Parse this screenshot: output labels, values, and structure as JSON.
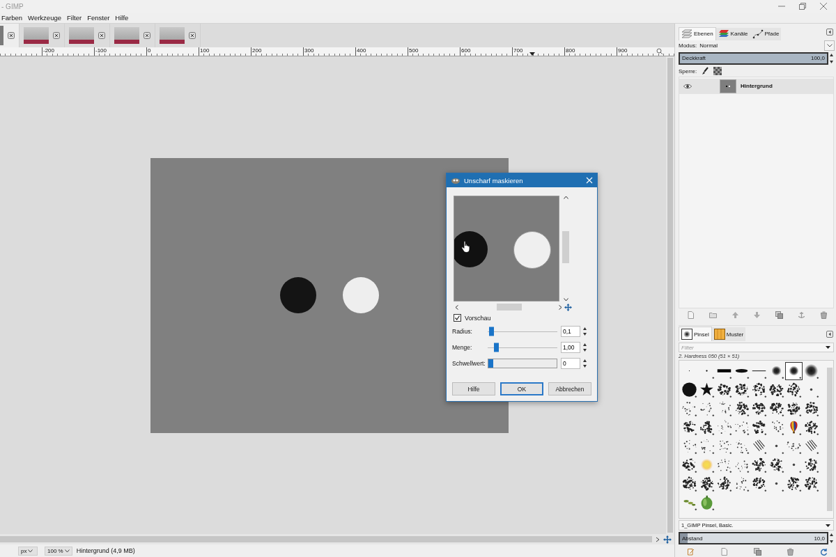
{
  "window": {
    "title": "- GIMP"
  },
  "menu": [
    "Farben",
    "Werkzeuge",
    "Filter",
    "Fenster",
    "Hilfe"
  ],
  "image_tabs": [
    {
      "kind": "blank",
      "selected": true
    },
    {
      "kind": "photo",
      "selected": false
    },
    {
      "kind": "photo",
      "selected": false
    },
    {
      "kind": "photo",
      "selected": false
    },
    {
      "kind": "photo",
      "selected": false
    }
  ],
  "ruler": {
    "labels": [
      "-200",
      "-100",
      "0",
      "100",
      "200",
      "300",
      "400",
      "500",
      "600",
      "700",
      "800",
      "900"
    ]
  },
  "dialog": {
    "title": "Unscharf maskieren",
    "preview": {
      "label": "Vorschau",
      "checked": true
    },
    "params": [
      {
        "kind": "slider",
        "label": "Radius:",
        "value": "0,1",
        "level": 0.02
      },
      {
        "kind": "slider",
        "label": "Menge:",
        "value": "1,00",
        "level": 0.1
      },
      {
        "kind": "scale",
        "label": "Schwellwert:",
        "value": "0",
        "level": 0
      }
    ],
    "buttons": [
      {
        "label": "Hilfe",
        "selected": false
      },
      {
        "label": "OK",
        "selected": true
      },
      {
        "label": "Abbrechen",
        "selected": false
      }
    ]
  },
  "status_bar": {
    "unit": "px",
    "zoom": "100 %",
    "info": "Hintergrund (4,9 MB)"
  },
  "layers_panel": {
    "tabs": [
      {
        "label": "Ebenen",
        "selected": true
      },
      {
        "label": "Kanäle",
        "selected": false
      },
      {
        "label": "Pfade",
        "selected": false
      }
    ],
    "mode_label": "Modus:",
    "mode": "Normal",
    "opacity": {
      "label": "Deckkraft",
      "value": "100,0",
      "level": 1
    },
    "lock_label": "Sperre:",
    "layers": [
      {
        "name": "Hintergrund",
        "visible": true,
        "selected": true
      }
    ]
  },
  "brushes_panel": {
    "tabs": [
      {
        "label": "Pinsel",
        "selected": true
      },
      {
        "label": "Muster",
        "selected": false
      }
    ],
    "filter": {
      "placeholder": "Filter"
    },
    "brush_name": "2. Hardness 050 (51 × 51)",
    "brushes": [
      {
        "kind": "pixel",
        "selected": false
      },
      {
        "kind": "dot",
        "selected": false
      },
      {
        "kind": "bar",
        "selected": false
      },
      {
        "kind": "ellipse",
        "selected": false
      },
      {
        "kind": "line",
        "selected": false
      },
      {
        "kind": "soft",
        "selected": false
      },
      {
        "kind": "soft",
        "selected": true
      },
      {
        "kind": "soft-large",
        "selected": false
      },
      {
        "kind": "disc",
        "selected": false
      },
      {
        "kind": "star",
        "selected": false
      },
      {
        "kind": "blob",
        "selected": false
      },
      {
        "kind": "blob",
        "selected": false
      },
      {
        "kind": "blob",
        "selected": false
      },
      {
        "kind": "blob",
        "selected": false
      },
      {
        "kind": "blob",
        "selected": false
      },
      {
        "kind": "speck",
        "selected": false
      },
      {
        "kind": "sparse",
        "selected": false
      },
      {
        "kind": "sparse",
        "selected": false
      },
      {
        "kind": "sparse",
        "selected": false
      },
      {
        "kind": "blob",
        "selected": false
      },
      {
        "kind": "blob",
        "selected": false
      },
      {
        "kind": "blob",
        "selected": false
      },
      {
        "kind": "blob",
        "selected": false
      },
      {
        "kind": "blob",
        "selected": false
      },
      {
        "kind": "blob",
        "selected": false
      },
      {
        "kind": "blob",
        "selected": false
      },
      {
        "kind": "sparse",
        "selected": false
      },
      {
        "kind": "sparse",
        "selected": false
      },
      {
        "kind": "blob",
        "selected": false
      },
      {
        "kind": "sparse",
        "selected": false
      },
      {
        "kind": "balloon",
        "selected": false
      },
      {
        "kind": "blob",
        "selected": false
      },
      {
        "kind": "sparse",
        "selected": false
      },
      {
        "kind": "sparse",
        "selected": false
      },
      {
        "kind": "sparse",
        "selected": false
      },
      {
        "kind": "sparse",
        "selected": false
      },
      {
        "kind": "hatch",
        "selected": false
      },
      {
        "kind": "speck",
        "selected": false
      },
      {
        "kind": "sparse",
        "selected": false
      },
      {
        "kind": "hatch",
        "selected": false
      },
      {
        "kind": "blob",
        "selected": false
      },
      {
        "kind": "sun",
        "selected": false
      },
      {
        "kind": "sparse",
        "selected": false
      },
      {
        "kind": "sparse",
        "selected": false
      },
      {
        "kind": "blob",
        "selected": false
      },
      {
        "kind": "blob",
        "selected": false
      },
      {
        "kind": "speck",
        "selected": false
      },
      {
        "kind": "blob",
        "selected": false
      },
      {
        "kind": "blob",
        "selected": false
      },
      {
        "kind": "blob",
        "selected": false
      },
      {
        "kind": "blob",
        "selected": false
      },
      {
        "kind": "sparse",
        "selected": false
      },
      {
        "kind": "blob",
        "selected": false
      },
      {
        "kind": "speck",
        "selected": false
      },
      {
        "kind": "blob",
        "selected": false
      },
      {
        "kind": "blob",
        "selected": false
      },
      {
        "kind": "leaf",
        "selected": false
      },
      {
        "kind": "pepper",
        "selected": false
      }
    ],
    "tag": "1_GIMP Pinsel, Basic.",
    "spacing": {
      "label": "Abstand",
      "value": "10,0",
      "level": 0.05
    }
  }
}
